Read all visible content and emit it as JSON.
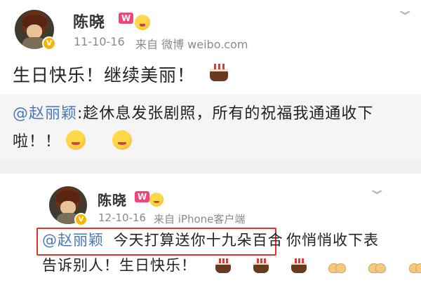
{
  "post1": {
    "author": "陈晓",
    "rank_badge": "W",
    "verified_badge": "V",
    "timestamp": "11-10-16",
    "source": "来自 微博 weibo.com",
    "content": "生日快乐！继续美丽！",
    "repost": {
      "mention": "@赵丽颖",
      "line1": ":趁休息发张剧照，所有的祝福我通通收下",
      "line2": "啦！！"
    },
    "expand_icon": "chevron-down-icon"
  },
  "post2": {
    "author": "陈晓",
    "rank_badge": "W",
    "verified_badge": "V",
    "timestamp": "12-10-16",
    "source": "来自 iPhone客户端",
    "mention": "@赵丽颖",
    "highlighted_text": "今天打算送你十九朵百合",
    "text_after": "你悄悄收下表",
    "line2": "告诉别人！生日快乐！",
    "expand_icon": "chevron-down-icon"
  },
  "colors": {
    "mention": "#4a7ab5",
    "highlight_box": "#e5322d",
    "verified": "#f7b500",
    "divider": "#f0f0f0"
  }
}
